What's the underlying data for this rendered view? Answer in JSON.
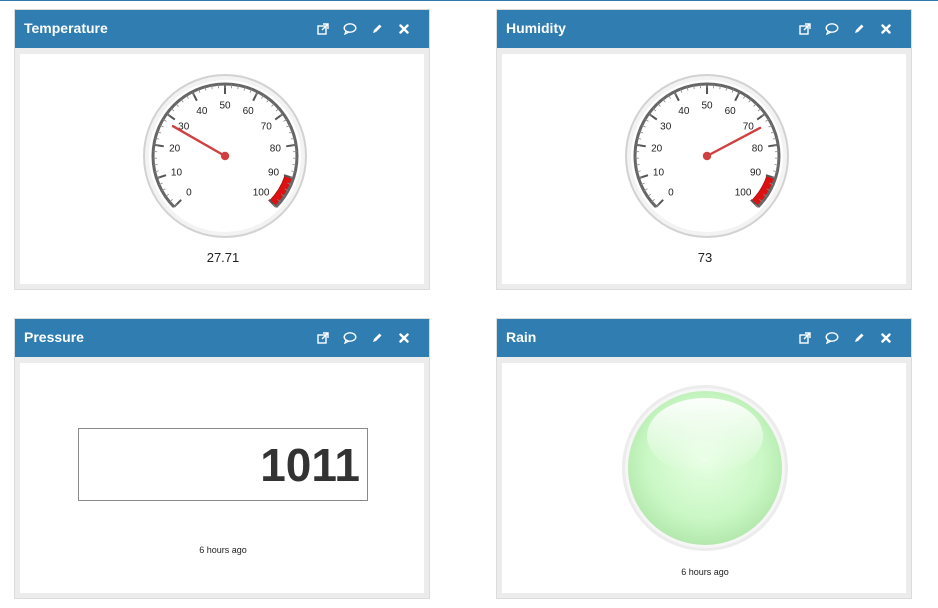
{
  "widgets": {
    "temperature": {
      "title": "Temperature",
      "value": "27.71",
      "gauge": {
        "min": 0,
        "max": 100,
        "value": 27.71,
        "ticks": [
          "0",
          "10",
          "20",
          "30",
          "40",
          "50",
          "60",
          "70",
          "80",
          "90",
          "100"
        ],
        "redband": [
          90,
          100
        ]
      }
    },
    "humidity": {
      "title": "Humidity",
      "value": "73",
      "gauge": {
        "min": 0,
        "max": 100,
        "value": 73,
        "ticks": [
          "0",
          "10",
          "20",
          "30",
          "40",
          "50",
          "60",
          "70",
          "80",
          "90",
          "100"
        ],
        "redband": [
          90,
          100
        ]
      }
    },
    "pressure": {
      "title": "Pressure",
      "value": "1011",
      "updated": "6 hours ago"
    },
    "rain": {
      "title": "Rain",
      "led_color": "#c9f7c4",
      "updated": "6 hours ago"
    }
  },
  "tools": [
    "external-link-icon",
    "comment-icon",
    "pencil-icon",
    "close-icon"
  ],
  "colors": {
    "header": "#2f7db1",
    "needle": "#d04040",
    "redband": "#dd1111",
    "led": "#c9f7c4"
  }
}
